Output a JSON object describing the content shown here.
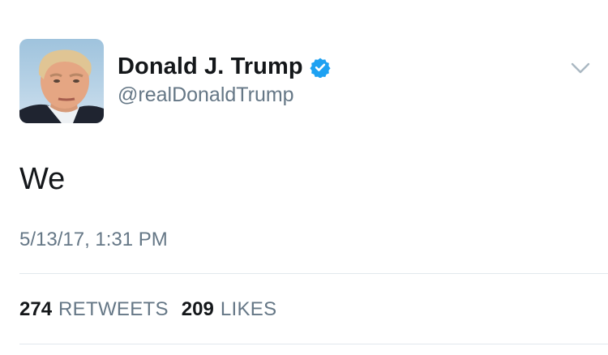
{
  "tweet": {
    "display_name": "Donald J. Trump",
    "handle": "@realDonaldTrump",
    "text": "We",
    "timestamp": "5/13/17, 1:31 PM",
    "retweets_count": "274",
    "retweets_label": "RETWEETS",
    "likes_count": "209",
    "likes_label": "LIKES",
    "verified_icon": "verified-badge-icon",
    "menu_icon": "chevron-down-icon",
    "colors": {
      "name": "#14171a",
      "secondary": "#657786",
      "verified": "#1da1f2",
      "divider": "#e1e8ed"
    }
  }
}
